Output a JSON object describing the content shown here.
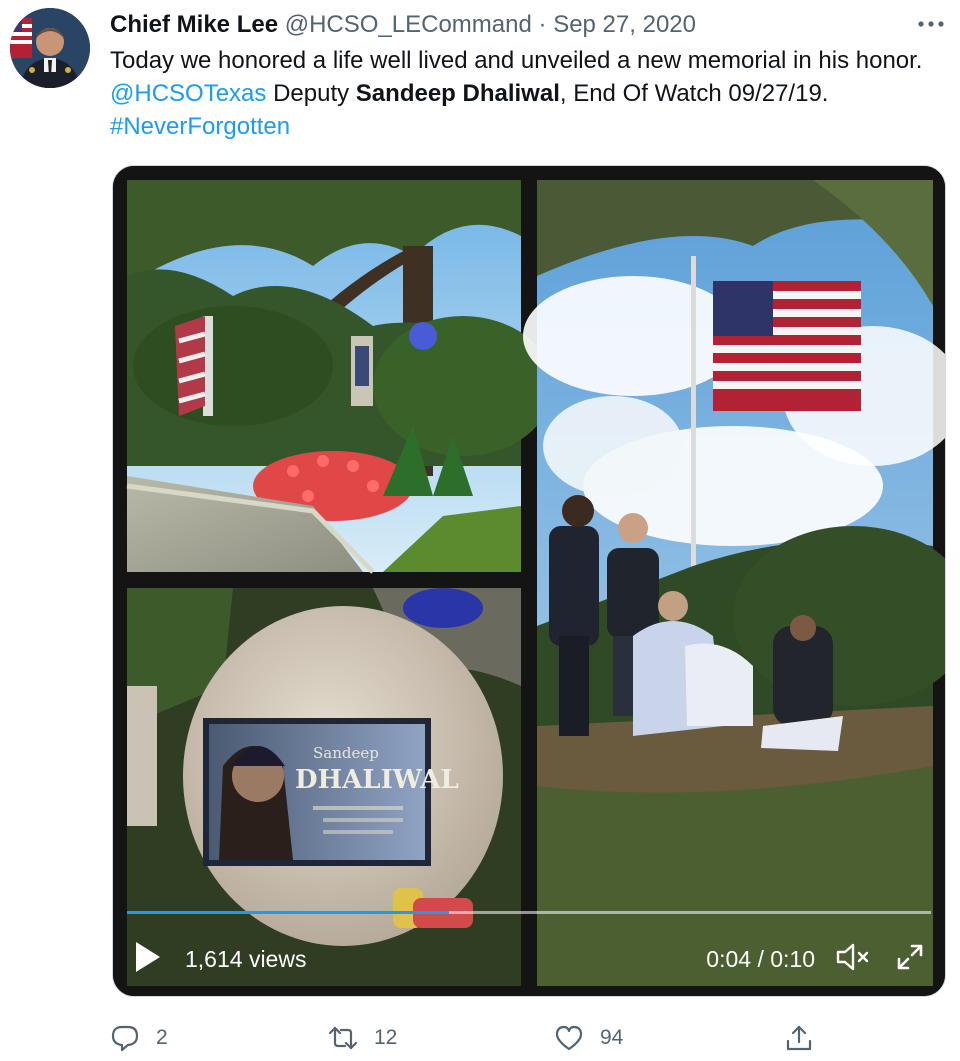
{
  "tweet": {
    "display_name": "Chief Mike Lee",
    "handle": "@HCSO_LECommand",
    "separator": "·",
    "date": "Sep 27, 2020",
    "text": {
      "line1": "Today we honored a life well lived and unveiled a new memorial in his honor.",
      "mention": "@HCSOTexas",
      "deputy_prefix": " Deputy ",
      "deputy_name": "Sandeep Dhaliwal",
      "end_of_watch": ", End Of Watch 09/27/19.",
      "hashtag": "#NeverForgotten"
    }
  },
  "video": {
    "views": "1,614 views",
    "time": "0:04 / 0:10",
    "progress": 0.4,
    "plaque_name": "DHALIWAL",
    "plaque_first": "Sandeep"
  },
  "actions": {
    "reply_count": "2",
    "retweet_count": "12",
    "like_count": "94"
  },
  "icons": {
    "more": "more-icon",
    "play": "play-icon",
    "mute": "volume-muted-icon",
    "fullscreen": "fullscreen-icon",
    "reply": "reply-icon",
    "retweet": "retweet-icon",
    "like": "heart-icon",
    "share": "share-icon"
  },
  "colors": {
    "link": "#1d9bf0",
    "muted": "#536471",
    "text": "#0f1419"
  }
}
